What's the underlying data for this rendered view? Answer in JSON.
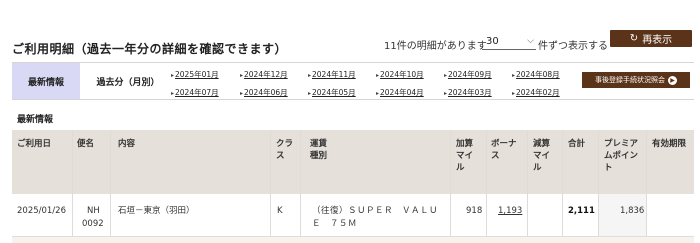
{
  "header": {
    "title": "ご利用明細（過去一年分の詳細を確認できます）",
    "count_text": "11件の明細があります",
    "per_page_value": "30",
    "per_page_suffix": "件ずつ表示する",
    "redisplay_label": "再表示"
  },
  "tabs": {
    "latest_label": "最新情報",
    "past_label": "過去分（月別）",
    "months_row1": [
      "2025年01月",
      "2024年12月",
      "2024年11月",
      "2024年10月",
      "2024年09月",
      "2024年08月"
    ],
    "months_row2": [
      "2024年07月",
      "2024年06月",
      "2024年05月",
      "2024年04月",
      "2024年03月",
      "2024年02月"
    ],
    "status_button_label": "事後登録手続状況照会"
  },
  "section_label": "最新情報",
  "table": {
    "headers": {
      "date": "ご利用日",
      "flight": "便名",
      "content": "内容",
      "class": "クラス",
      "fare_line1": "運賃",
      "fare_line2": "種別",
      "added_miles": "加算マイル",
      "bonus": "ボーナス",
      "reduced_miles": "減算マイル",
      "total": "合計",
      "premium_points": "プレミアムポイント",
      "expiry": "有効期限"
    },
    "rows": [
      {
        "date": "2025/01/26",
        "flight_line1": "NH",
        "flight_line2": "0092",
        "content": "石垣－東京（羽田）",
        "class": "K",
        "fare_line1": "（往復）ＳＵＰＥＲ　ＶＡＬＵ",
        "fare_line2": "Ｅ　７５Ｍ",
        "added_miles": "918",
        "bonus": "1,193",
        "reduced_miles": "",
        "total": "2,111",
        "premium_points": "1,836",
        "expiry": ""
      }
    ]
  },
  "colors": {
    "brand_brown": "#5a3318",
    "active_tab": "#d9d9f5",
    "table_header": "#e6e0da"
  }
}
